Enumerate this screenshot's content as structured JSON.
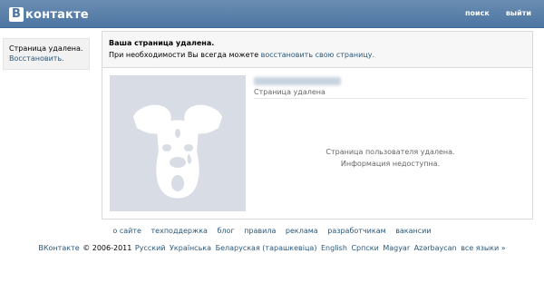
{
  "header": {
    "logo_letter": "B",
    "logo_text": "контакте",
    "nav": {
      "search": "поиск",
      "logout": "выйти"
    }
  },
  "sidebar": {
    "status": "Страница удалена.",
    "restore": "Восстановить."
  },
  "notice": {
    "title": "Ваша страница удалена.",
    "text": "При необходимости Вы всегда можете",
    "restore_link": "восстановить свою страницу."
  },
  "profile": {
    "status": "Страница удалена",
    "message_line1": "Страница пользователя удалена.",
    "message_line2": "Информация недоступна."
  },
  "footer": {
    "links": [
      "о сайте",
      "техподдержка",
      "блог",
      "правила",
      "реклама",
      "разработчикам",
      "вакансии"
    ],
    "brand": "ВКонтакте",
    "copyright": "© 2006-2011",
    "languages": [
      "Русский",
      "Українська",
      "Беларуская (тарашкевіца)",
      "English",
      "Српски",
      "Magyar",
      "Azərbaycan",
      "все языки »"
    ]
  },
  "colors": {
    "header": "#4d76a1",
    "link": "#2b587a",
    "avatar_bg": "#d8dde5",
    "avatar_fg": "#ffffff"
  }
}
